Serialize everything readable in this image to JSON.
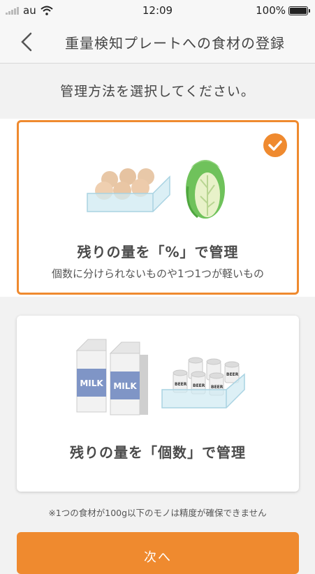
{
  "status_bar": {
    "carrier": "au",
    "time": "12:09",
    "battery": "100%",
    "battery_level": 1.0
  },
  "nav": {
    "back_icon": "chevron-left-icon",
    "title": "重量検知プレートへの食材の登録"
  },
  "prompt": "管理方法を選択してください。",
  "options": [
    {
      "title": "残りの量を「%」で管理",
      "subtitle": "個数に分けられないものや1つ1つが軽いもの",
      "selected": true,
      "icons": [
        "egg-tray-icon",
        "cabbage-icon"
      ]
    },
    {
      "title": "残りの量を「個数」で管理",
      "subtitle": "",
      "selected": false,
      "icons": [
        "milk-carton-icon",
        "beer-can-tray-icon"
      ],
      "carton_label": "MILK",
      "can_label": "BEER"
    }
  ],
  "note": "※1つの食材が100g以下のモノは精度が確保できません",
  "next_button": "次へ",
  "colors": {
    "accent": "#ef8a2f",
    "milk_blue": "#7f95c6"
  }
}
